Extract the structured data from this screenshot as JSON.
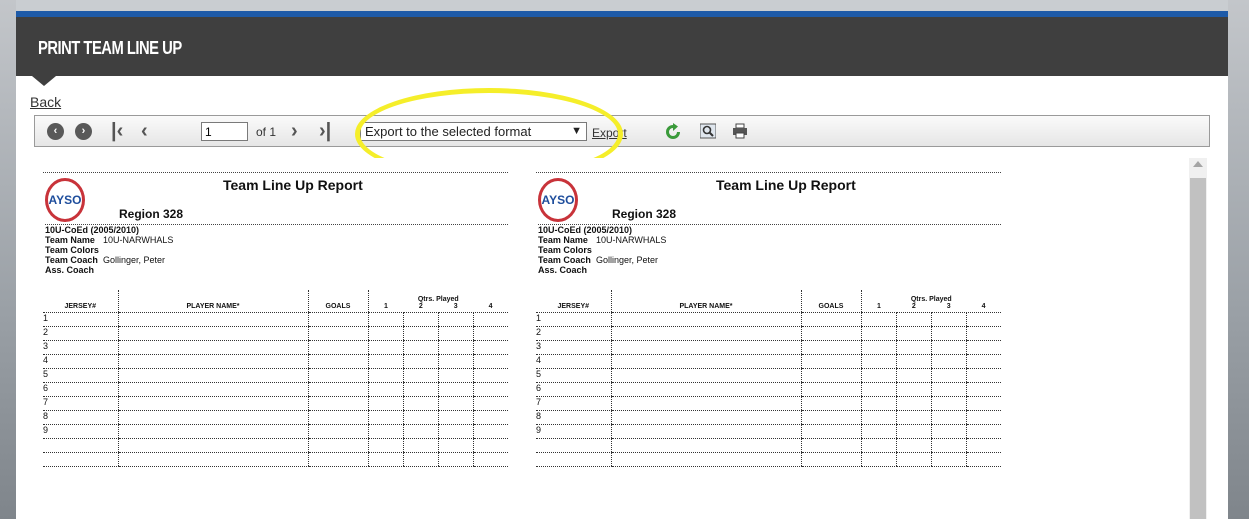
{
  "header": {
    "title": "PRINT TEAM LINE UP"
  },
  "nav": {
    "back_label": "Back"
  },
  "toolbar": {
    "page_current": "1",
    "page_of": "of 1",
    "export_format": "Export to the selected format",
    "export_label": "Export",
    "icons": [
      "back-circle-icon",
      "forward-circle-icon",
      "first-page-icon",
      "prev-page-icon",
      "next-page-icon",
      "last-page-icon",
      "refresh-icon",
      "search-icon",
      "print-icon"
    ]
  },
  "report": {
    "title": "Team Line Up Report",
    "region": "Region 328",
    "division": "10U-CoEd (2005/2010)",
    "fields": [
      {
        "key": "Team Name",
        "value": "10U-NARWHALS"
      },
      {
        "key": "Team Colors",
        "value": ""
      },
      {
        "key": "Team Coach",
        "value": "Gollinger, Peter"
      },
      {
        "key": "Ass. Coach",
        "value": ""
      }
    ],
    "columns": {
      "jersey": "JERSEY#",
      "player": "PLAYER NAME*",
      "goals": "GOALS",
      "qtrs": "Qtrs. Played",
      "q": [
        "1",
        "2",
        "3",
        "4"
      ]
    },
    "rows": [
      "1",
      "2",
      "3",
      "4",
      "5",
      "6",
      "7",
      "8",
      "9",
      "",
      ""
    ]
  },
  "colors": {
    "header_bg": "#3f3f3f",
    "accent_bar": "#1d5aa8",
    "highlight": "#f5ee2a"
  }
}
